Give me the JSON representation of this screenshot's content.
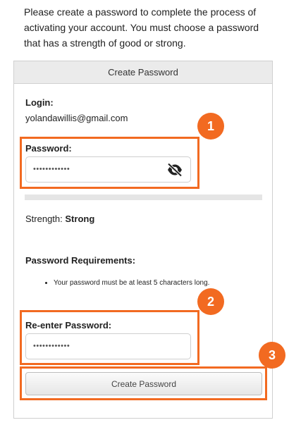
{
  "intro": {
    "text": "Please create a password to complete the process of activating your account. You must choose a password that has a strength of good or strong."
  },
  "panel": {
    "title": "Create Password",
    "login_label": "Login:",
    "login_value": "yolandawillis@gmail.com",
    "password_label": "Password:",
    "password_value": "••••••••••••",
    "strength_label": "Strength:",
    "strength_value": "Strong",
    "requirements_title": "Password Requirements:",
    "requirements": [
      "Your password must be at least 5 characters long."
    ],
    "reenter_label": "Re-enter Password:",
    "reenter_value": "••••••••••••",
    "submit_label": "Create Password"
  },
  "annotations": {
    "badge1": "1",
    "badge2": "2",
    "badge3": "3",
    "color": "#f26a21"
  },
  "icons": {
    "password_toggle": "eye-slash-icon"
  }
}
